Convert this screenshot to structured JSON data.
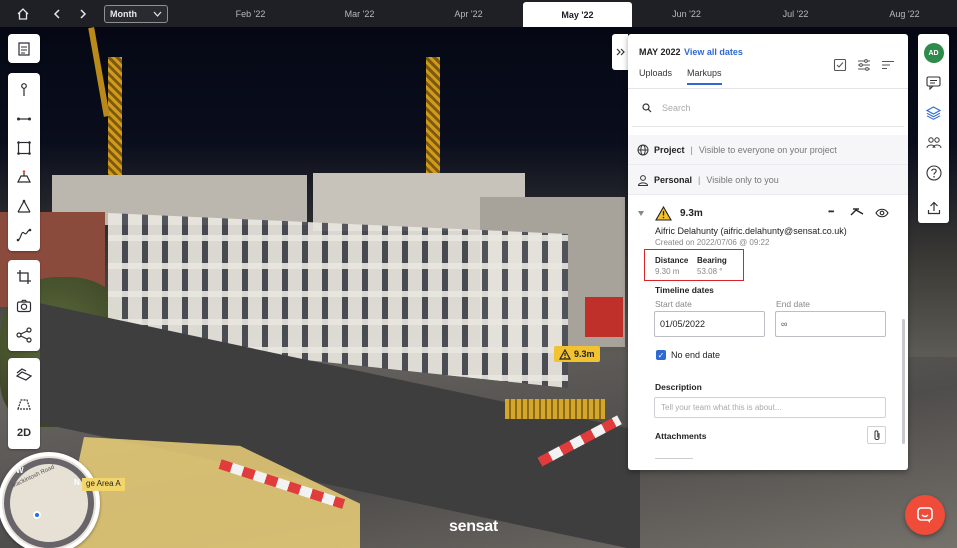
{
  "timeline": {
    "period_select": "Month",
    "months": [
      "Feb '22",
      "Mar '22",
      "Apr '22",
      "May '22",
      "Jun '22",
      "Jul '22",
      "Aug '22"
    ],
    "active_month": "May '22"
  },
  "left_toolbar": {
    "view_mode_label": "2D"
  },
  "scene": {
    "measure_tag": "9.3m",
    "area_tag": "ge Area A",
    "brand": "sensat",
    "compass_w": "W",
    "compass_n": "N",
    "map_road": "Mackintosh Road"
  },
  "panel": {
    "date_title": "MAY 2022",
    "view_all_link": "View all dates",
    "tabs": [
      {
        "label": "Uploads",
        "active": false
      },
      {
        "label": "Markups",
        "active": true
      }
    ],
    "search_placeholder": "Search",
    "layers": [
      {
        "name": "Project",
        "description": "Visible to everyone on your project",
        "icon": "globe-icon"
      },
      {
        "name": "Personal",
        "description": "Visible only to you",
        "icon": "person-icon"
      }
    ],
    "markup": {
      "title": "9.3m",
      "more": "•••",
      "author": "Aifric Delahunty (aifric.delahunty@sensat.co.uk)",
      "created": "Created on 2022/07/06 @ 09:22",
      "distance_label": "Distance",
      "distance_value": "9.30 m",
      "bearing_label": "Bearing",
      "bearing_value": "53.08 °",
      "timeline_heading": "Timeline dates",
      "start_label": "Start date",
      "end_label": "End date",
      "start_value": "01/05/2022",
      "end_value": "∞",
      "no_end_date_label": "No end date",
      "no_end_date_checked": true,
      "description_label": "Description",
      "description_placeholder": "Tell your team what this is about...",
      "attachments_label": "Attachments"
    }
  },
  "right_bar": {
    "avatar_initials": "AD"
  },
  "colors": {
    "accent": "#2f6ad3",
    "warning": "#f2c230",
    "highlight": "#d8232a",
    "chat": "#ef4c3a",
    "avatar": "#2e8b4a"
  }
}
